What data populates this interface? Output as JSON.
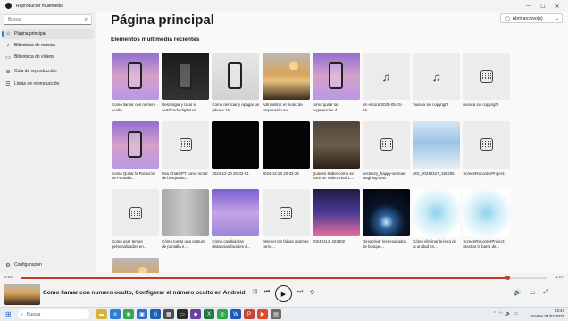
{
  "window": {
    "title": "Reproductor multimedia"
  },
  "sidebar": {
    "search_placeholder": "Buscar",
    "items": [
      {
        "label": "Página principal",
        "icon": "home-icon"
      },
      {
        "label": "Biblioteca de música",
        "icon": "music-note-icon"
      },
      {
        "label": "Biblioteca de vídeos",
        "icon": "video-icon"
      },
      {
        "label": "Cola de reproducción",
        "icon": "queue-icon"
      },
      {
        "label": "Listas de reproducción",
        "icon": "playlist-icon"
      }
    ],
    "settings_label": "Configuración"
  },
  "main": {
    "title": "Página principal",
    "open_button": "Abrir archivo(s)",
    "section_title": "Elementos multimedia recientes",
    "media": [
      {
        "caption": "Como llamar con numero oculto...",
        "thumb": "phone"
      },
      {
        "caption": "Descargar y Usar el certificado digital en...",
        "thumb": "phone2"
      },
      {
        "caption": "Cómo reiniciar y Apagar un Iphone 16...",
        "thumb": "screen"
      },
      {
        "caption": "Administrar el modo de suspensión en...",
        "thumb": "photo"
      },
      {
        "caption": "como quitar las sugerencias d...",
        "thumb": "phone"
      },
      {
        "caption": "vlc-record-2023-05-01-16...",
        "thumb": "music"
      },
      {
        "caption": "musica sin copyright",
        "thumb": "music"
      },
      {
        "caption": "musica sin copyright",
        "thumb": "film"
      },
      {
        "caption": "Como Quitar la Rotación de Pantalla...",
        "thumb": "phone"
      },
      {
        "caption": "Usa ChatGPT como motor de búsqueda...",
        "thumb": "film"
      },
      {
        "caption": "2024-12-20 20-32-51",
        "thumb": "black"
      },
      {
        "caption": "2024-12-20 20-33-22",
        "thumb": "black"
      },
      {
        "caption": "Quieres Saber como se hace un Video Viral. L...",
        "thumb": "car"
      },
      {
        "caption": "vecteezy_happy-woman-laughing-and...",
        "thumb": "film"
      },
      {
        "caption": "VID_20240327_190255",
        "thumb": "room"
      },
      {
        "caption": "ScreenRecorderProject1",
        "thumb": "film"
      },
      {
        "caption": "Como usar temas personalizados en...",
        "thumb": "film"
      },
      {
        "caption": "Cómo tomar una captura de pantalla e...",
        "thumb": "twophones"
      },
      {
        "caption": "Cómo cambiar las distancias faciales d...",
        "thumb": "hands"
      },
      {
        "caption": "Detener las falsas alarmas como...",
        "thumb": "film"
      },
      {
        "caption": "20249114_223802",
        "thumb": "apps"
      },
      {
        "caption": "Desactivar los resultados de busque...",
        "thumb": "eclipse"
      },
      {
        "caption": "Cómo eliminar la letra de la unidad en...",
        "thumb": "flower"
      },
      {
        "caption": "ScreenRecorderProject1 Mostrar la barra de...",
        "thumb": "flower"
      },
      {
        "caption": "",
        "thumb": "photo"
      }
    ]
  },
  "player": {
    "elapsed": "0:03",
    "duration": "1:07",
    "progress": 0.925,
    "now_playing": "Como llamar con numero oculto, Configurar el número oculto en Android"
  },
  "taskbar": {
    "search_placeholder": "Buscar",
    "time": "23:47",
    "date": "martes 04/02/2025"
  },
  "colors": {
    "accent": "#c9372c",
    "nav_indicator": "#3b7bd6"
  }
}
